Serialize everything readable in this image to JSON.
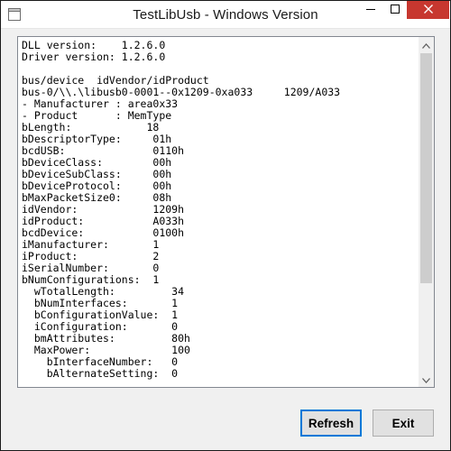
{
  "window": {
    "title": "TestLibUsb - Windows Version"
  },
  "icons": {
    "app": "app-window-icon",
    "minimize": "minimize-icon",
    "maximize": "maximize-icon",
    "close": "close-icon",
    "scroll_up": "chevron-up-icon",
    "scroll_down": "chevron-down-icon"
  },
  "colors": {
    "close_button": "#c7372f",
    "focus_border": "#0078d7"
  },
  "log": {
    "lines": [
      "DLL version:    1.2.6.0",
      "Driver version: 1.2.6.0",
      "",
      "bus/device  idVendor/idProduct",
      "bus-0/\\\\.\\libusb0-0001--0x1209-0xa033     1209/A033",
      "- Manufacturer : area0x33",
      "- Product      : MemType",
      "bLength:            18",
      "bDescriptorType:     01h",
      "bcdUSB:              0110h",
      "bDeviceClass:        00h",
      "bDeviceSubClass:     00h",
      "bDeviceProtocol:     00h",
      "bMaxPacketSize0:     08h",
      "idVendor:            1209h",
      "idProduct:           A033h",
      "bcdDevice:           0100h",
      "iManufacturer:       1",
      "iProduct:            2",
      "iSerialNumber:       0",
      "bNumConfigurations:  1",
      "  wTotalLength:         34",
      "  bNumInterfaces:       1",
      "  bConfigurationValue:  1",
      "  iConfiguration:       0",
      "  bmAttributes:         80h",
      "  MaxPower:             100",
      "    bInterfaceNumber:   0",
      "    bAlternateSetting:  0"
    ]
  },
  "scrollbar": {
    "position_fraction": 0.0,
    "visible_fraction": 0.72
  },
  "buttons": {
    "refresh_label": "Refresh",
    "exit_label": "Exit"
  }
}
